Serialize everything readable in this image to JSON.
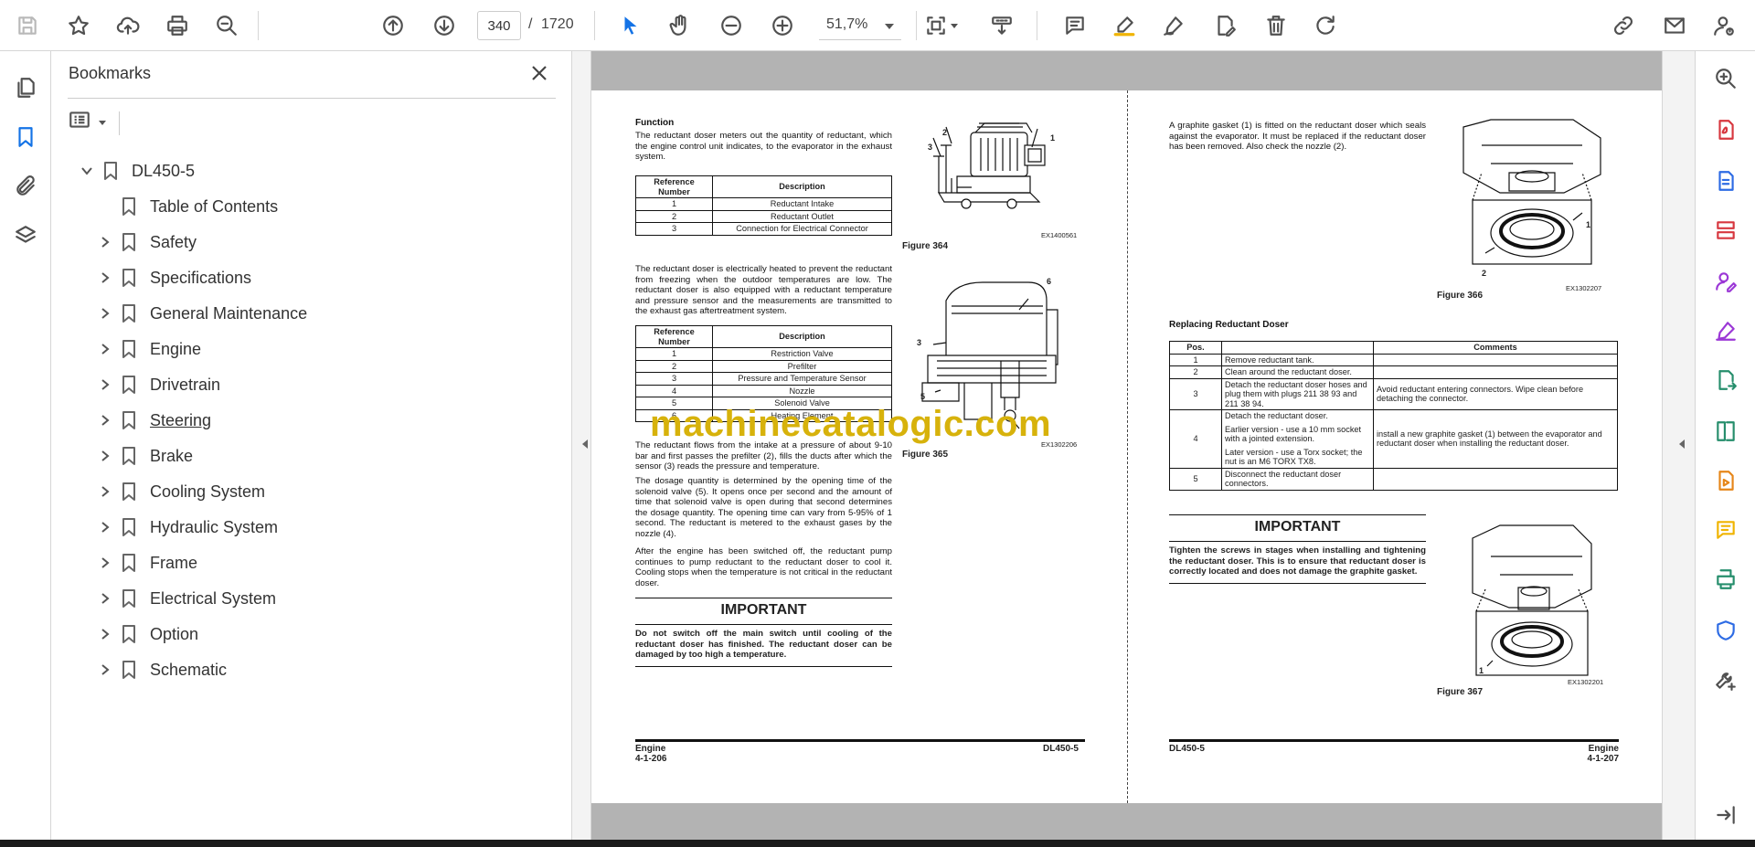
{
  "toolbar": {
    "page_current": "340",
    "page_separator": "/",
    "page_total": "1720",
    "zoom": "51,7%"
  },
  "bookmarks": {
    "title": "Bookmarks",
    "items": [
      {
        "label": "DL450-5",
        "level": 0,
        "expanded": true
      },
      {
        "label": "Table of Contents",
        "level": 1,
        "children": false
      },
      {
        "label": "Safety",
        "level": 1,
        "children": true
      },
      {
        "label": "Specifications",
        "level": 1,
        "children": true
      },
      {
        "label": "General Maintenance",
        "level": 1,
        "children": true
      },
      {
        "label": "Engine",
        "level": 1,
        "children": true
      },
      {
        "label": "Drivetrain",
        "level": 1,
        "children": true
      },
      {
        "label": "Steering",
        "level": 1,
        "children": true,
        "hovered": true
      },
      {
        "label": "Brake",
        "level": 1,
        "children": true
      },
      {
        "label": "Cooling System",
        "level": 1,
        "children": true
      },
      {
        "label": "Hydraulic System",
        "level": 1,
        "children": true
      },
      {
        "label": "Frame",
        "level": 1,
        "children": true
      },
      {
        "label": "Electrical System",
        "level": 1,
        "children": true
      },
      {
        "label": "Option",
        "level": 1,
        "children": true
      },
      {
        "label": "Schematic",
        "level": 1,
        "children": true
      }
    ]
  },
  "page_left": {
    "function_heading": "Function",
    "function_text": "The reductant doser meters out the quantity of reductant, which the engine control unit indicates, to the evaporator in the exhaust system.",
    "table1": {
      "headers": [
        "Reference Number",
        "Description"
      ],
      "rows": [
        [
          "1",
          "Reductant Intake"
        ],
        [
          "2",
          "Reductant Outlet"
        ],
        [
          "3",
          "Connection for Electrical Connector"
        ]
      ]
    },
    "figure1_caption": "Figure 364",
    "figure1_code": "EX1400561",
    "heated_text": "The reductant doser is electrically heated to prevent the reductant from freezing when the outdoor temperatures are low. The reductant doser is also equipped with a reductant temperature and pressure sensor and the measurements are transmitted to the exhaust gas aftertreatment system.",
    "table2": {
      "headers": [
        "Reference Number",
        "Description"
      ],
      "rows": [
        [
          "1",
          "Restriction Valve"
        ],
        [
          "2",
          "Prefilter"
        ],
        [
          "3",
          "Pressure and Temperature Sensor"
        ],
        [
          "4",
          "Nozzle"
        ],
        [
          "5",
          "Solenoid Valve"
        ],
        [
          "6",
          "Heating Element"
        ]
      ]
    },
    "figure2_caption": "Figure 365",
    "figure2_code": "EX1302206",
    "flow_text": "The reductant flows from the intake at a pressure of about 9-10 bar and first passes the prefilter (2), fills the ducts after which the sensor (3) reads the pressure and temperature.",
    "dosage_text": "The dosage quantity is determined by the opening time of the solenoid valve (5). It opens once per second and the amount of time that solenoid valve is open during that second determines the dosage quantity. The opening time can vary from 5-95% of 1 second. The reductant is metered to the exhaust gases by the nozzle (4).",
    "after_text": "After the engine has been switched off, the reductant pump continues to pump reductant to the reductant doser to cool it. Cooling stops when the temperature is not critical in the reductant doser.",
    "important_heading": "IMPORTANT",
    "important_text": "Do not switch off the main switch until cooling of the reductant doser has finished. The reductant doser can be damaged by too high a temperature.",
    "footer_left_title": "Engine",
    "footer_left_page": "4-1-206",
    "footer_right_model": "DL450-5"
  },
  "page_right": {
    "gasket_text": "A graphite gasket (1) is fitted on the reductant doser which seals against the evaporator. It must be replaced if the reductant doser has been removed. Also check the nozzle (2).",
    "figure3_caption": "Figure 366",
    "figure3_code": "EX1302207",
    "replacing_heading": "Replacing Reductant Doser",
    "table3": {
      "headers": [
        "Pos.",
        "",
        "Comments"
      ],
      "rows": [
        {
          "pos": "1",
          "step": "Remove reductant tank.",
          "comment": ""
        },
        {
          "pos": "2",
          "step": "Clean around the reductant doser.",
          "comment": ""
        },
        {
          "pos": "3",
          "step": "Detach the reductant doser hoses and plug them with plugs 211 38 93 and 211 38 94.",
          "comment": "Avoid reductant entering connectors. Wipe clean before detaching the connector."
        },
        {
          "pos": "4",
          "step": "Detach the reductant doser.",
          "step2": "Earlier version - use a 10 mm socket with a jointed extension.",
          "step3": "Later version - use a Torx socket; the nut is an M6 TORX TX8.",
          "comment": "install a new graphite gasket (1) between the evaporator and reductant doser when installing the reductant doser."
        },
        {
          "pos": "5",
          "step": "Disconnect the reductant doser connectors.",
          "comment": ""
        }
      ]
    },
    "important_heading": "IMPORTANT",
    "important_text": "Tighten the screws in stages when installing and tightening the reductant doser. This is to ensure that reductant doser is correctly located and does not damage the graphite gasket.",
    "figure4_caption": "Figure 367",
    "figure4_code": "EX1302201",
    "footer_left_model": "DL450-5",
    "footer_right_title": "Engine",
    "footer_right_page": "4-1-207"
  },
  "watermark": "machinecatalogic.com",
  "colors": {
    "accent": "#1473e6",
    "tool_pink": "#d7373f",
    "tool_blue": "#2d6be4",
    "tool_purple": "#9b37d6",
    "tool_green": "#268e6c",
    "tool_orange": "#e68619",
    "tool_yellow": "#f0b400",
    "tool_gray": "#505050",
    "watermark": "#d7b20b"
  }
}
